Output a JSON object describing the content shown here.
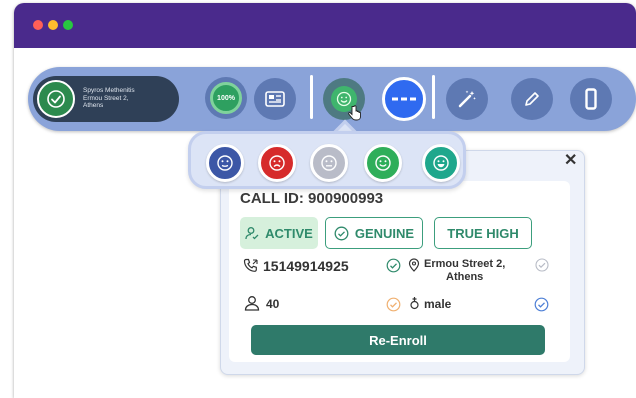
{
  "window": {
    "colors": {
      "titlebar": "#4a2a8c",
      "toolbar": "#8aa3d9",
      "accent": "#2f7a6a"
    }
  },
  "toolbar": {
    "caller": {
      "name": "Spyros Methenitis",
      "address_line1": "Ermou Street 2,",
      "address_line2": "Athens",
      "icon": "check-circle-icon"
    },
    "score_label": "100%",
    "buttons": [
      {
        "name": "id-card-button",
        "icon": "id-card-icon"
      },
      {
        "name": "emotion-button",
        "icon": "smile-icon"
      },
      {
        "name": "more-button",
        "icon": "ellipsis-icon"
      },
      {
        "name": "magic-wand-button",
        "icon": "magic-wand-icon"
      },
      {
        "name": "edit-button",
        "icon": "pencil-icon"
      },
      {
        "name": "device-button",
        "icon": "device-icon"
      }
    ]
  },
  "emotions": [
    {
      "name": "neutral",
      "color": "#3c57a6"
    },
    {
      "name": "angry",
      "color": "#d62b2b"
    },
    {
      "name": "disabled",
      "color": "#b9bcc8"
    },
    {
      "name": "happy",
      "color": "#2fae5a"
    },
    {
      "name": "very-happy",
      "color": "#1fa78c"
    }
  ],
  "card": {
    "call_id": "CALL ID: 900900993",
    "badges": {
      "active": "ACTIVE",
      "genuine": "GENUINE",
      "true_high": "TRUE HIGH"
    },
    "phone": "15149914925",
    "address_line1": "Ermou Street 2,",
    "address_line2": "Athens",
    "age": "40",
    "gender": "male",
    "close_label": "✕",
    "reenroll_label": "Re-Enroll"
  }
}
